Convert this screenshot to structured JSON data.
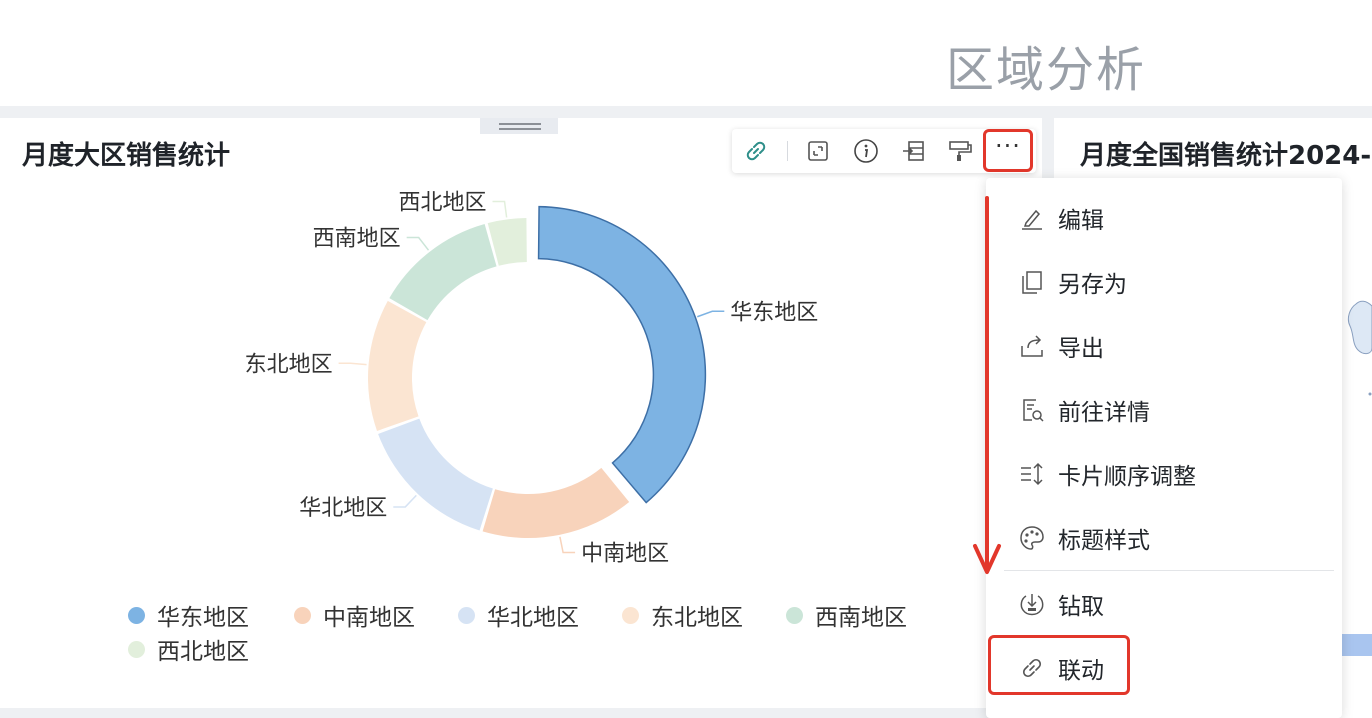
{
  "page": {
    "title": "区域分析"
  },
  "left_card": {
    "title": "月度大区销售统计"
  },
  "right_card": {
    "title": "月度全国销售统计2024-"
  },
  "toolbar": {
    "icons": [
      "link-icon",
      "fullscreen-icon",
      "info-icon",
      "export-card-icon",
      "format-painter-icon",
      "more-icon"
    ],
    "more_label": "···"
  },
  "menu": {
    "items": [
      {
        "label": "编辑",
        "icon": "edit-icon"
      },
      {
        "label": "另存为",
        "icon": "copy-icon"
      },
      {
        "label": "导出",
        "icon": "export-icon"
      },
      {
        "label": "前往详情",
        "icon": "detail-icon"
      },
      {
        "label": "卡片顺序调整",
        "icon": "sort-icon"
      },
      {
        "label": "标题样式",
        "icon": "palette-icon"
      },
      {
        "label": "钻取",
        "icon": "drill-icon"
      },
      {
        "label": "联动",
        "icon": "link-icon"
      }
    ]
  },
  "chart_data": {
    "type": "pie",
    "subtype": "donut",
    "categories": [
      "华东地区",
      "中南地区",
      "华北地区",
      "东北地区",
      "西南地区",
      "西北地区"
    ],
    "values": [
      37,
      15,
      14,
      13,
      12,
      4
    ],
    "colors": [
      "#7db3e3",
      "#f8d3bb",
      "#d6e3f4",
      "#fbe5d2",
      "#cbe5d8",
      "#e2efdc"
    ],
    "highlighted": "华东地区",
    "legend": "bottom"
  }
}
